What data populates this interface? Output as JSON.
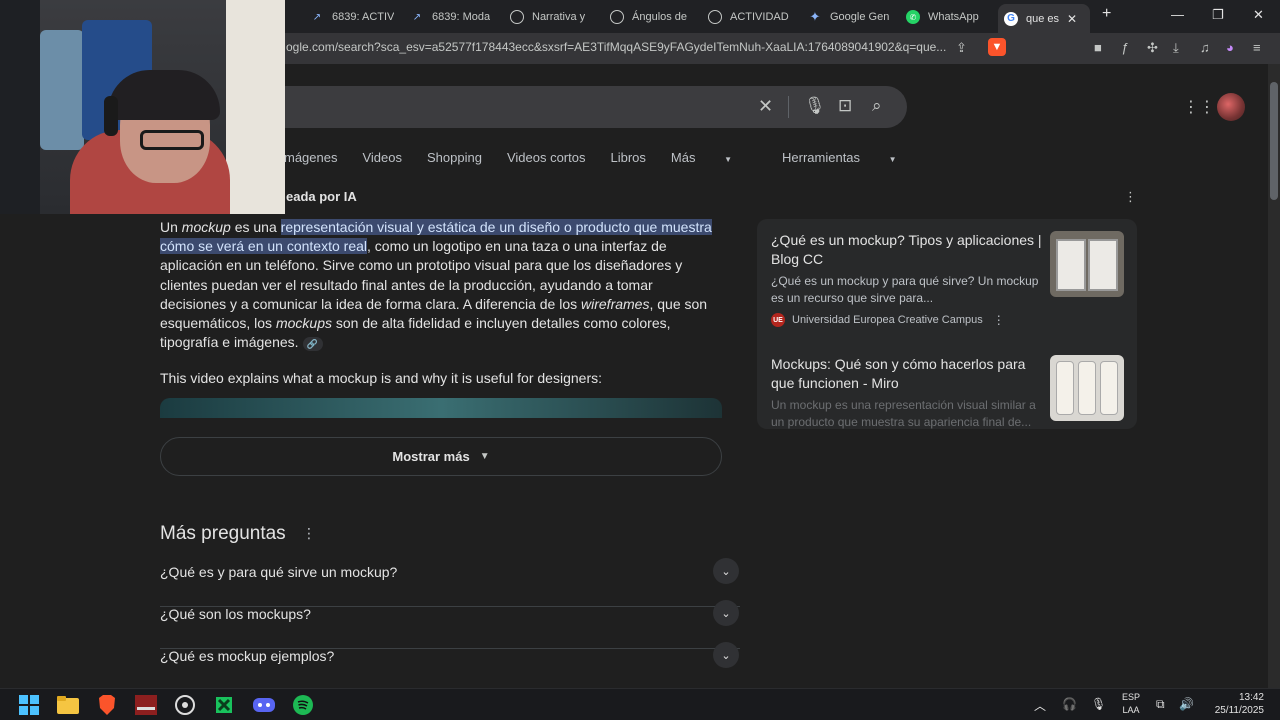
{
  "tabs": [
    {
      "label": "6839: ACTIV",
      "icon": "project-icon"
    },
    {
      "label": "6839: Moda",
      "icon": "project-icon"
    },
    {
      "label": "Narrativa y",
      "icon": "globe-icon"
    },
    {
      "label": "Ángulos de",
      "icon": "globe-icon"
    },
    {
      "label": "ACTIVIDAD",
      "icon": "globe-icon"
    },
    {
      "label": "Google Gen",
      "icon": "gemini-icon"
    },
    {
      "label": "WhatsApp",
      "icon": "whatsapp-icon"
    },
    {
      "label": "que es",
      "icon": "google-icon",
      "active": true
    }
  ],
  "tab_close": "✕",
  "new_tab": "+",
  "window_controls": {
    "minimize": "—",
    "maximize": "❐",
    "close": "✕"
  },
  "url": "ogle.com/search?sca_esv=a52577f178443ecc&sxsrf=AE3TifMqqASE9yFAGydeITemNuh-XaaLIA:1764089041902&q=que...",
  "filters": [
    "mágenes",
    "Videos",
    "Shopping",
    "Videos cortos",
    "Libros",
    "Más",
    "Herramientas"
  ],
  "ai_overview": {
    "header": "eada por IA",
    "p_un": "Un ",
    "p_mockup1": "mockup",
    "p_esuna": " es una ",
    "p_highlight": "representación visual y estática de un diseño o producto que muestra cómo se verá en un contexto real",
    "p_rest1": ", como un logotipo en una taza o una interfaz de aplicación en un teléfono. Sirve como un prototipo visual para que los diseñadores y clientes puedan ver el resultado final antes de la producción, ayudando a tomar decisiones y a comunicar la idea de forma clara. A diferencia de los ",
    "p_wireframes": "wireframes",
    "p_rest2": ", que son esquemáticos, los ",
    "p_mockups2": "mockups",
    "p_rest3": " son de alta fidelidad e incluyen detalles como colores, tipografía e imágenes.",
    "video_intro": "This video explains what a mockup is and why it is useful for designers:",
    "show_more": "Mostrar más"
  },
  "sources": [
    {
      "title": "¿Qué es un mockup? Tipos y aplicaciones | Blog CC",
      "snippet": "¿Qué es un mockup y para qué sirve? Un mockup es un recurso que sirve para...",
      "site": "Universidad Europea Creative Campus",
      "badge": "UE"
    },
    {
      "title": "Mockups: Qué son y cómo hacerlos para que funcionen - Miro",
      "snippet": "Un mockup es una representación visual similar a un producto que muestra su apariencia final de..."
    }
  ],
  "more_questions": {
    "title": "Más preguntas",
    "items": [
      "¿Qué es y para qué sirve un mockup?",
      "¿Qué son los mockups?",
      "¿Qué es mockup ejemplos?"
    ]
  },
  "taskbar": {
    "apps": [
      "windows-start",
      "file-explorer",
      "brave",
      "voicemeeter",
      "obs-studio",
      "krita",
      "discord",
      "spotify"
    ],
    "lang_top": "ESP",
    "lang_bottom": "LAA",
    "time": "13:42",
    "date": "25/11/2025"
  },
  "colors": {
    "page_bg": "#1f1f1f",
    "highlight": "#3c4a6e",
    "accent_brave": "#fb542b",
    "whatsapp": "#25d366",
    "spotify": "#1db954"
  }
}
